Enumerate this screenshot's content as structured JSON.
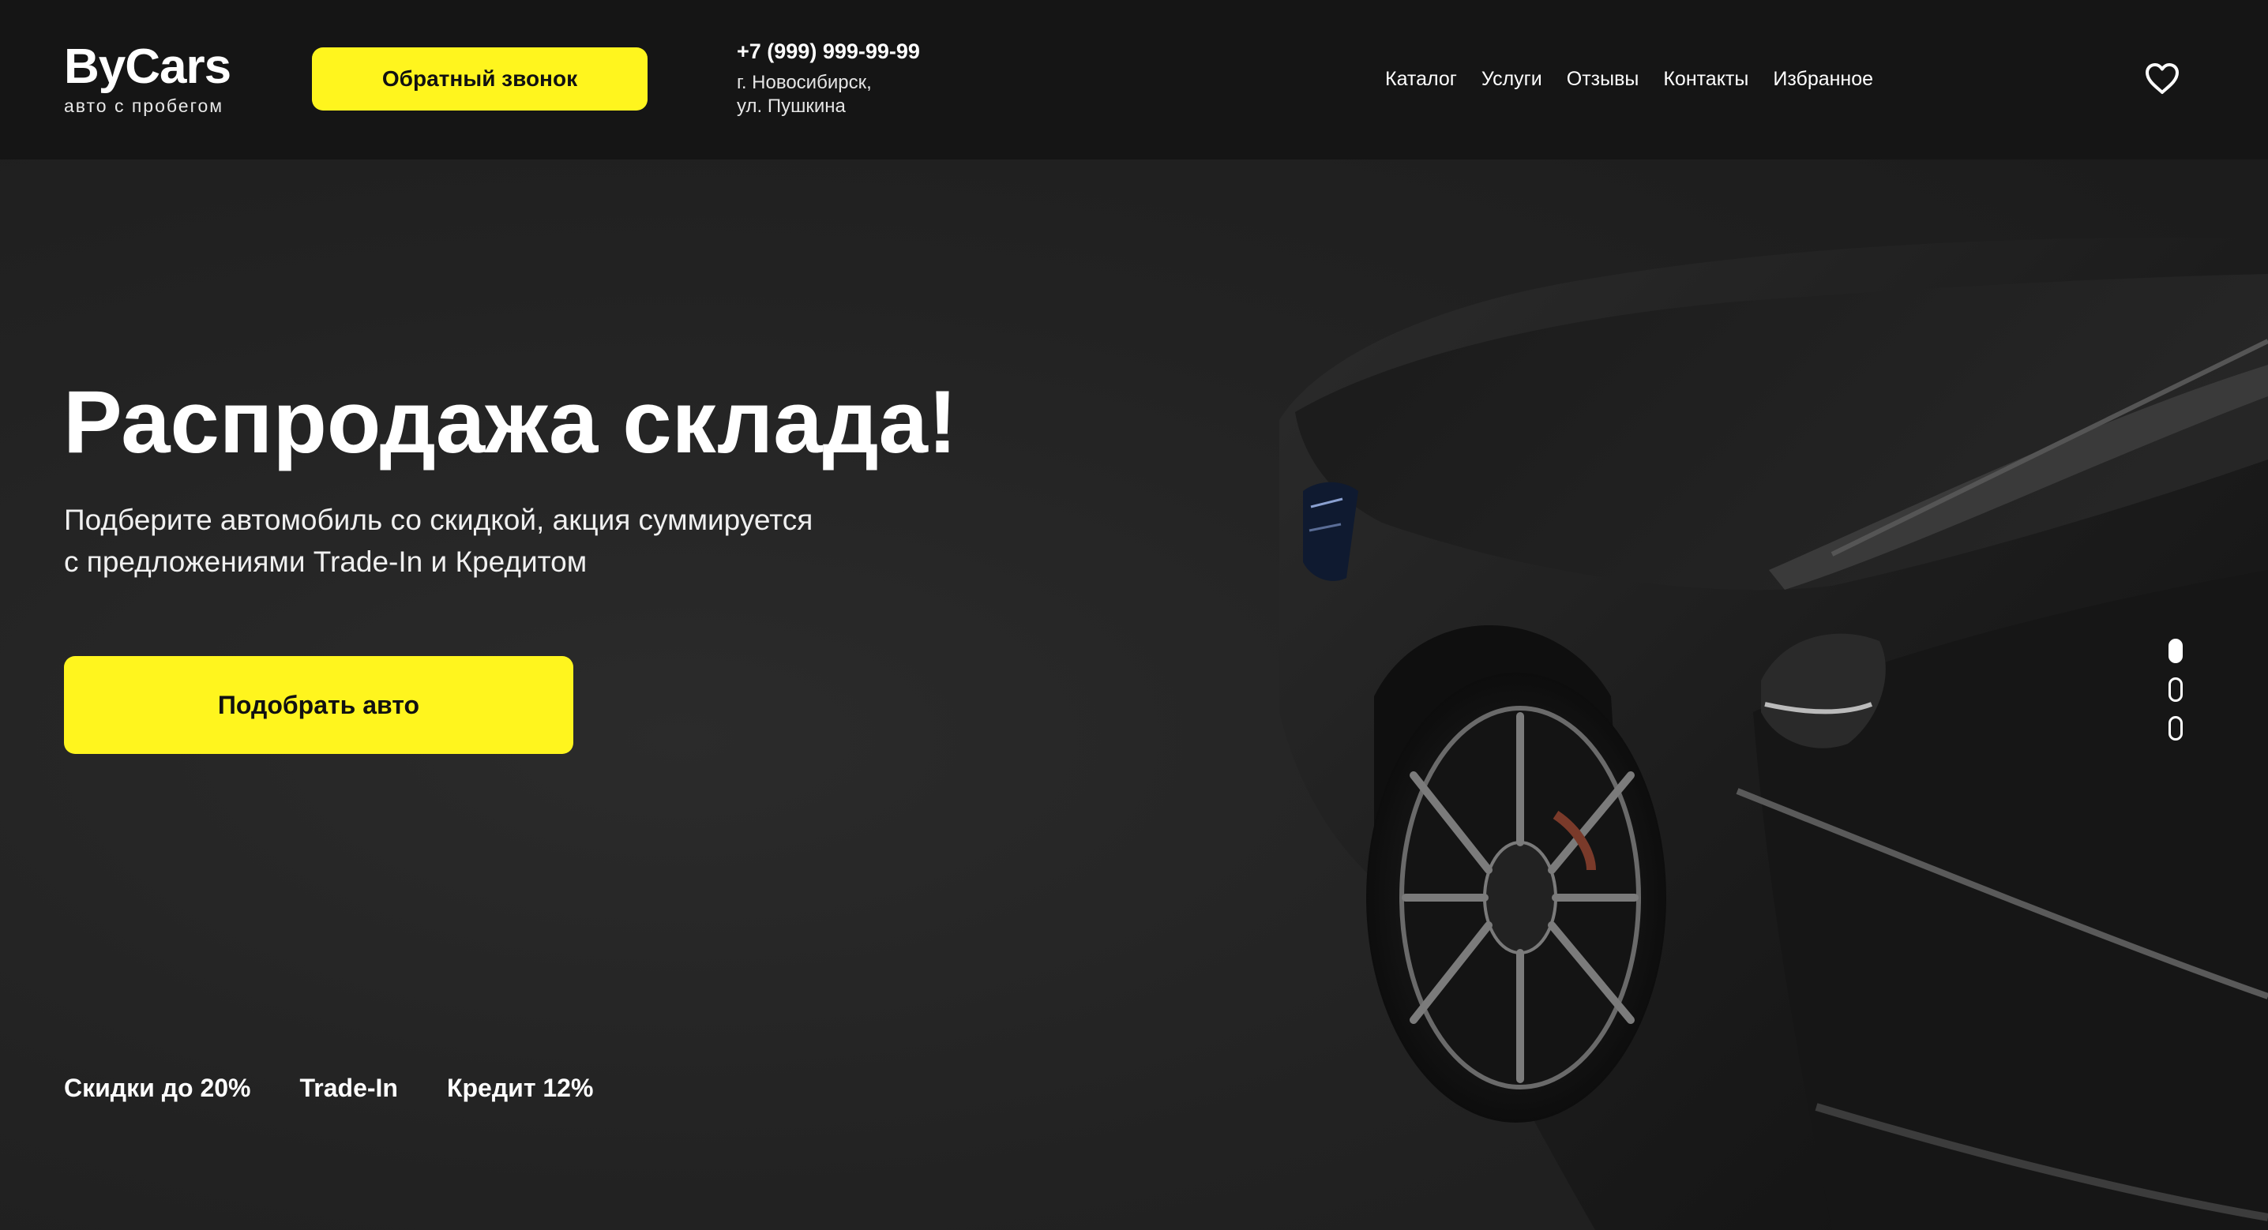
{
  "header": {
    "logo_title": "ByCars",
    "logo_subtitle": "авто с пробегом",
    "callback_label": "Обратный звонок",
    "phone": "+7 (999) 999-99-99",
    "address_line1": "г. Новосибирск,",
    "address_line2": "ул. Пушкина",
    "nav": [
      {
        "label": "Каталог"
      },
      {
        "label": "Услуги"
      },
      {
        "label": "Отзывы"
      },
      {
        "label": "Контакты"
      },
      {
        "label": "Избранное"
      }
    ],
    "favorite_icon": "heart-icon"
  },
  "hero": {
    "title": "Распродажа склада!",
    "text_line1": "Подберите автомобиль со скидкой, акция суммируется",
    "text_line2": "с предложениями Trade-In и Кредитом",
    "button_label": "Подобрать авто",
    "features": [
      {
        "label": "Скидки до 20%"
      },
      {
        "label": "Trade-In"
      },
      {
        "label": "Кредит 12%"
      }
    ]
  },
  "slider": {
    "count": 3,
    "active_index": 0
  },
  "colors": {
    "accent": "#fff51e",
    "header_bg": "#151515",
    "page_bg": "#222222",
    "text": "#ffffff"
  }
}
